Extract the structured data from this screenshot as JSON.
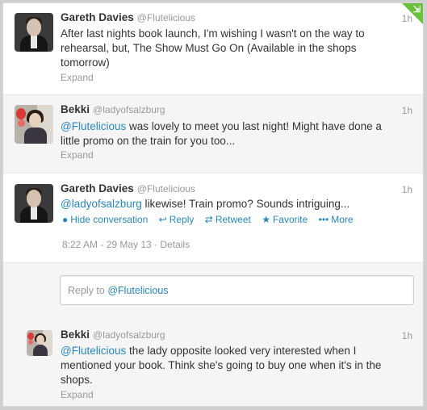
{
  "tweets": [
    {
      "name": "Gareth Davies",
      "handle": "@Flutelicious",
      "time": "1h",
      "text": "After last nights book launch, I'm wishing I wasn't on the way to rehearsal, but, The Show Must Go On (Available in the shops tomorrow)",
      "expand": "Expand"
    },
    {
      "name": "Bekki",
      "handle": "@ladyofsalzburg",
      "time": "1h",
      "mention": "@Flutelicious",
      "text": " was lovely to meet you last night! Might have done a little promo on the train for you too...",
      "expand": "Expand"
    },
    {
      "name": "Gareth Davies",
      "handle": "@Flutelicious",
      "time": "1h",
      "mention": "@ladyofsalzburg",
      "text": " likewise! Train promo? Sounds intriguing...",
      "actions": {
        "hide": "Hide conversation",
        "reply": "Reply",
        "retweet": "Retweet",
        "favorite": "Favorite",
        "more": "More"
      },
      "timestamp": "8:22 AM - 29 May 13",
      "separator": "·",
      "details": "Details"
    },
    {
      "name": "Bekki",
      "handle": "@ladyofsalzburg",
      "time": "1h",
      "mention": "@Flutelicious",
      "text": " the lady opposite looked very interested when I mentioned your book. Think she's going to buy one when it's in the shops.",
      "expand": "Expand"
    }
  ],
  "reply_box": {
    "prefix": "Reply to ",
    "mention": "@Flutelicious"
  },
  "icons": {
    "corner": "retweeted-corner-icon",
    "hide": "conversation-bubble-icon",
    "reply": "reply-arrow-icon",
    "retweet": "retweet-icon",
    "favorite": "star-icon",
    "more": "more-dots-icon"
  },
  "colors": {
    "link": "#2a87b8",
    "corner": "#6abf3c",
    "muted": "#999999"
  }
}
